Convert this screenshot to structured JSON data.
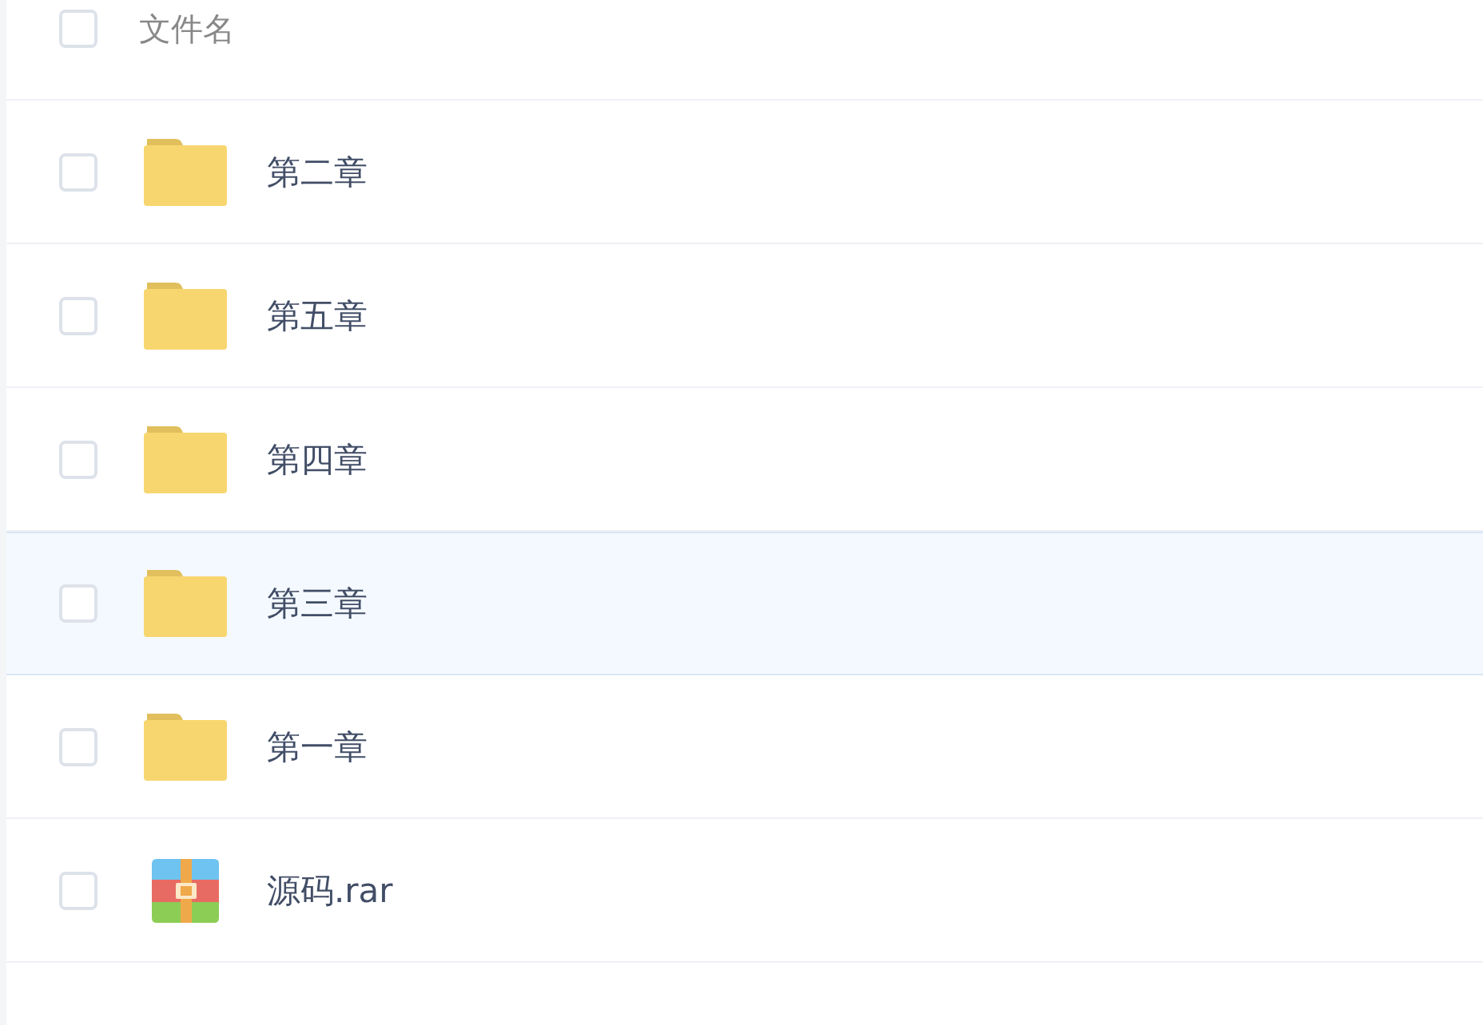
{
  "header": {
    "checked": false,
    "label": "文件名"
  },
  "rows": [
    {
      "name": "第二章",
      "kind": "folder",
      "checked": false,
      "selected": false
    },
    {
      "name": "第五章",
      "kind": "folder",
      "checked": false,
      "selected": false
    },
    {
      "name": "第四章",
      "kind": "folder",
      "checked": false,
      "selected": false
    },
    {
      "name": "第三章",
      "kind": "folder",
      "checked": false,
      "selected": true
    },
    {
      "name": "第一章",
      "kind": "folder",
      "checked": false,
      "selected": false
    },
    {
      "name": "源码.rar",
      "kind": "archive",
      "checked": false,
      "selected": false
    }
  ]
}
